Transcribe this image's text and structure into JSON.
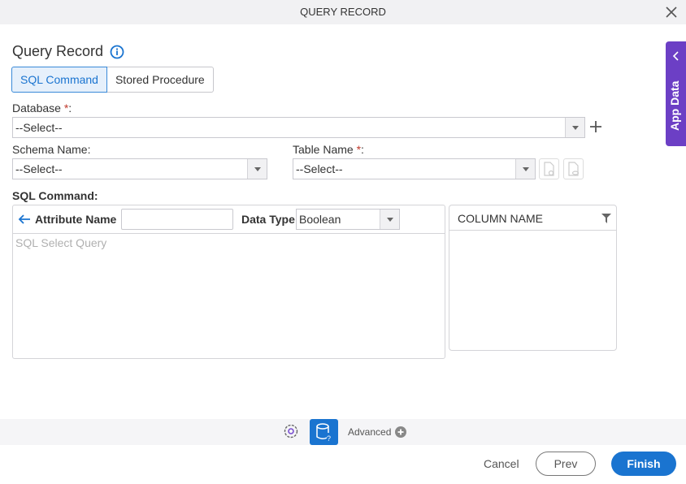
{
  "window": {
    "title": "QUERY RECORD",
    "close_icon": "close-icon"
  },
  "heading": {
    "title": "Query Record",
    "info_icon": "info-icon"
  },
  "tabs": [
    {
      "label": "SQL Command",
      "active": true
    },
    {
      "label": "Stored Procedure",
      "active": false
    }
  ],
  "database": {
    "label": "Database",
    "required_mark": "*",
    "suffix": ":",
    "value": "--Select--"
  },
  "schema": {
    "label": "Schema Name:",
    "value": "--Select--"
  },
  "table": {
    "label": "Table Name",
    "required_mark": "*",
    "suffix": ":",
    "value": "--Select--"
  },
  "sql_command": {
    "label": "SQL Command:",
    "attribute_label": "Attribute Name",
    "attribute_value": "",
    "data_type_label": "Data Type",
    "data_type_value": "Boolean",
    "query_placeholder": "SQL Select Query"
  },
  "columns": {
    "header": "COLUMN NAME"
  },
  "app_data": {
    "label": "App Data"
  },
  "bottom": {
    "advanced_label": "Advanced"
  },
  "footer": {
    "cancel": "Cancel",
    "prev": "Prev",
    "finish": "Finish"
  },
  "colors": {
    "accent": "#1a74d0",
    "app_data_bg": "#6c3fc5",
    "required": "#c0392b"
  }
}
